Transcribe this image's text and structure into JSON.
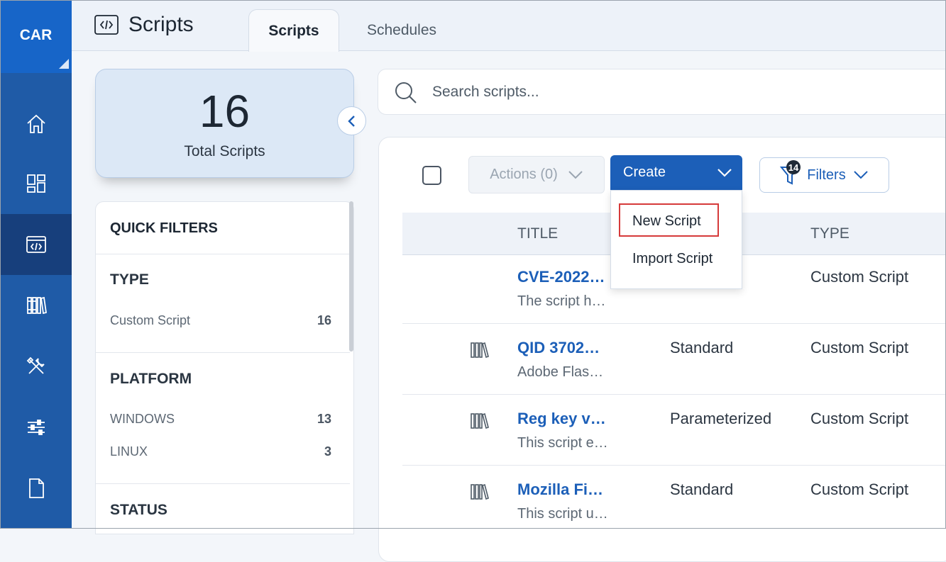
{
  "rail": {
    "brand": "CAR",
    "items": [
      {
        "icon": "home-icon"
      },
      {
        "icon": "dashboard-icon"
      },
      {
        "icon": "code-icon",
        "active": true
      },
      {
        "icon": "library-icon"
      },
      {
        "icon": "tools-icon"
      },
      {
        "icon": "sliders-icon"
      },
      {
        "icon": "document-icon"
      }
    ]
  },
  "header": {
    "title": "Scripts",
    "tabs": [
      {
        "label": "Scripts",
        "active": true
      },
      {
        "label": "Schedules",
        "active": false
      }
    ]
  },
  "summary": {
    "count": "16",
    "label": "Total Scripts"
  },
  "quick_filters": {
    "title": "QUICK FILTERS",
    "sections": [
      {
        "title": "TYPE",
        "rows": [
          {
            "label": "Custom Script",
            "count": "16"
          }
        ]
      },
      {
        "title": "PLATFORM",
        "rows": [
          {
            "label": "WINDOWS",
            "count": "13"
          },
          {
            "label": "LINUX",
            "count": "3"
          }
        ]
      },
      {
        "title": "STATUS",
        "rows": []
      }
    ]
  },
  "search": {
    "placeholder": "Search scripts..."
  },
  "toolbar": {
    "actions_label": "Actions (0)",
    "create_label": "Create",
    "filters_label": "Filters",
    "filters_badge": "14"
  },
  "create_menu": {
    "items": [
      "New Script",
      "Import Script"
    ],
    "highlighted": "New Script"
  },
  "table": {
    "columns": [
      "TITLE",
      "TYPE"
    ],
    "rows": [
      {
        "title": "CVE-2022…",
        "desc": "The script h…",
        "kind": "",
        "type": "Custom Script",
        "icon": ""
      },
      {
        "title": "QID 3702…",
        "desc": "Adobe Flas…",
        "kind": "Standard",
        "type": "Custom Script",
        "icon": "library-icon"
      },
      {
        "title": "Reg key v…",
        "desc": "This script e…",
        "kind": "Parameterized",
        "type": "Custom Script",
        "icon": "library-icon"
      },
      {
        "title": "Mozilla Fi…",
        "desc": "This script u…",
        "kind": "Standard",
        "type": "Custom Script",
        "icon": "library-icon"
      }
    ]
  },
  "colors": {
    "rail": "#1f5ba7",
    "rail_active": "#173f7c",
    "accent": "#1c5fb8",
    "highlight_border": "#d63a3a"
  }
}
